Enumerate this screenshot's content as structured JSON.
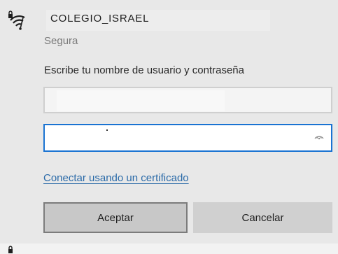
{
  "network": {
    "name": "COLEGIO_ISRAEL",
    "security_status": "Segura",
    "icon": "wifi-secured-icon"
  },
  "form": {
    "prompt": "Escribe tu nombre de usuario y contraseña",
    "username_value": "",
    "password_value": "",
    "reveal_icon": "eye-icon"
  },
  "links": {
    "certificate": "Conectar usando un certificado"
  },
  "buttons": {
    "accept": "Aceptar",
    "cancel": "Cancelar"
  },
  "colors": {
    "focus_border": "#1a73d2",
    "link": "#2a6aa8"
  }
}
